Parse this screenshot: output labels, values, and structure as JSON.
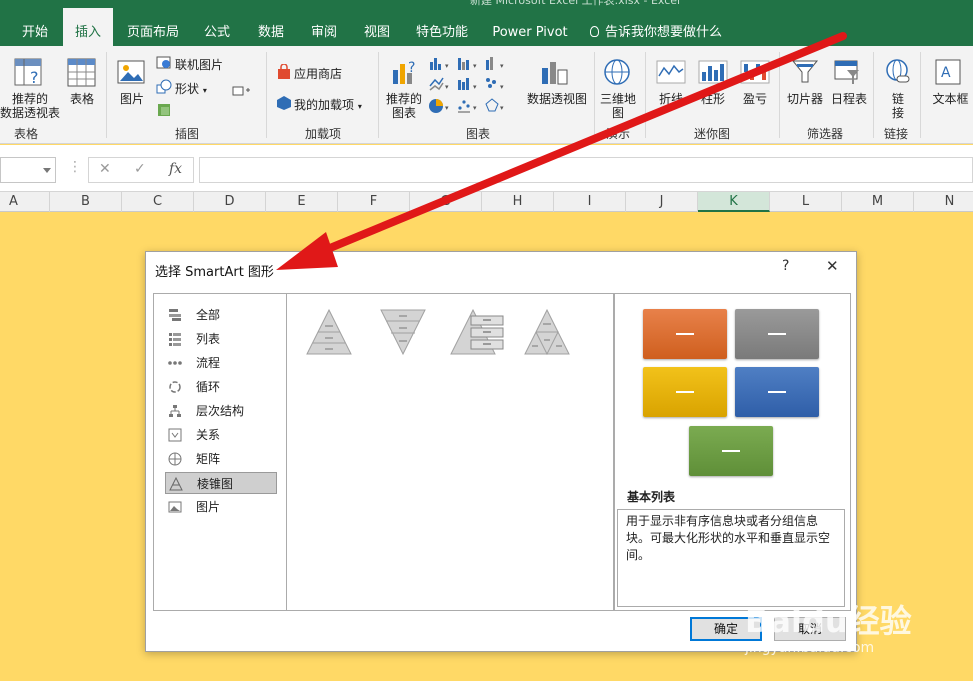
{
  "window": {
    "title": "新建 Microsoft Excel 工作表.xlsx - Excel"
  },
  "tabs": [
    {
      "label": "开始"
    },
    {
      "label": "插入"
    },
    {
      "label": "页面布局"
    },
    {
      "label": "公式"
    },
    {
      "label": "数据"
    },
    {
      "label": "审阅"
    },
    {
      "label": "视图"
    },
    {
      "label": "特色功能"
    },
    {
      "label": "Power Pivot"
    },
    {
      "label": "告诉我你想要做什么"
    }
  ],
  "ribbon": {
    "tables": {
      "pivot": "推荐的\n数据透视表",
      "table": "表格",
      "group": "表格"
    },
    "illustrations": {
      "picture": "图片",
      "online_picture": "联机图片",
      "shapes": "形状",
      "group": "插图"
    },
    "addins": {
      "store": "应用商店",
      "my_addins": "我的加载项",
      "group": "加载项"
    },
    "charts": {
      "recommended": "推荐的\n图表",
      "pivot_chart": "数据透视图",
      "group": "图表"
    },
    "tours": {
      "map3d": "三维地\n图",
      "group": "演示"
    },
    "sparklines": {
      "line": "折线",
      "column": "柱形",
      "winloss": "盈亏",
      "group": "迷你图"
    },
    "filters": {
      "slicer": "切片器",
      "timeline": "日程表",
      "group": "筛选器"
    },
    "links": {
      "link": "链\n接",
      "group": "链接"
    },
    "text": {
      "textbox": "文本框"
    }
  },
  "formula_bar": {
    "cancel": "✕",
    "enter": "✓",
    "fx": "fx"
  },
  "columns": [
    "A",
    "B",
    "C",
    "D",
    "E",
    "F",
    "G",
    "H",
    "I",
    "J",
    "K",
    "L",
    "M",
    "N"
  ],
  "dialog": {
    "title": "选择 SmartArt 图形",
    "help": "?",
    "close": "✕",
    "categories": [
      {
        "label": "全部"
      },
      {
        "label": "列表"
      },
      {
        "label": "流程"
      },
      {
        "label": "循环"
      },
      {
        "label": "层次结构"
      },
      {
        "label": "关系"
      },
      {
        "label": "矩阵"
      },
      {
        "label": "棱锥图"
      },
      {
        "label": "图片"
      }
    ],
    "selected_category": "棱锥图",
    "preview": {
      "title": "基本列表",
      "description": "用于显示非有序信息块或者分组信息块。可最大化形状的水平和垂直显示空间。",
      "colors": [
        "#e0722b",
        "#8c8c8c",
        "#e8b400",
        "#3f6db3",
        "#6e9e44"
      ]
    },
    "ok": "确定",
    "cancel": "取消"
  },
  "watermark": {
    "brand": "Baidu经验",
    "url": "jingyan.baidu.com"
  }
}
